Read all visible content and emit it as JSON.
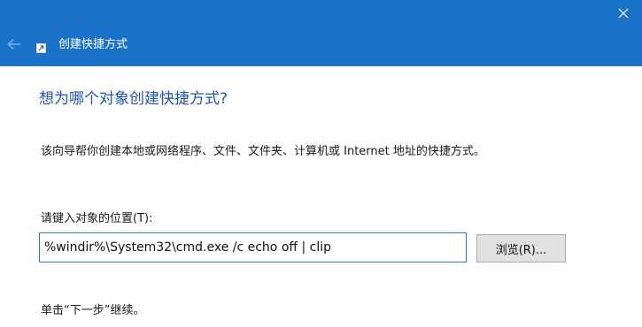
{
  "window": {
    "title": "创建快捷方式",
    "icons": {
      "back": "back-arrow-icon",
      "close": "close-icon",
      "app": "shortcut-icon"
    }
  },
  "page": {
    "heading": "想为哪个对象创建快捷方式?",
    "description": "该向导帮你创建本地或网络程序、文件、文件夹、计算机或 Internet 地址的快捷方式。",
    "location_label": "请键入对象的位置(T):",
    "location_value": "%windir%\\System32\\cmd.exe /c echo off | clip",
    "browse_label": "浏览(R)...",
    "footer_hint": "单击“下一步”继续。"
  },
  "colors": {
    "titlebar": "#1a73c8",
    "heading": "#1c56b0",
    "input_border": "#1e7fd6",
    "button_bg": "#e1e1e1"
  }
}
